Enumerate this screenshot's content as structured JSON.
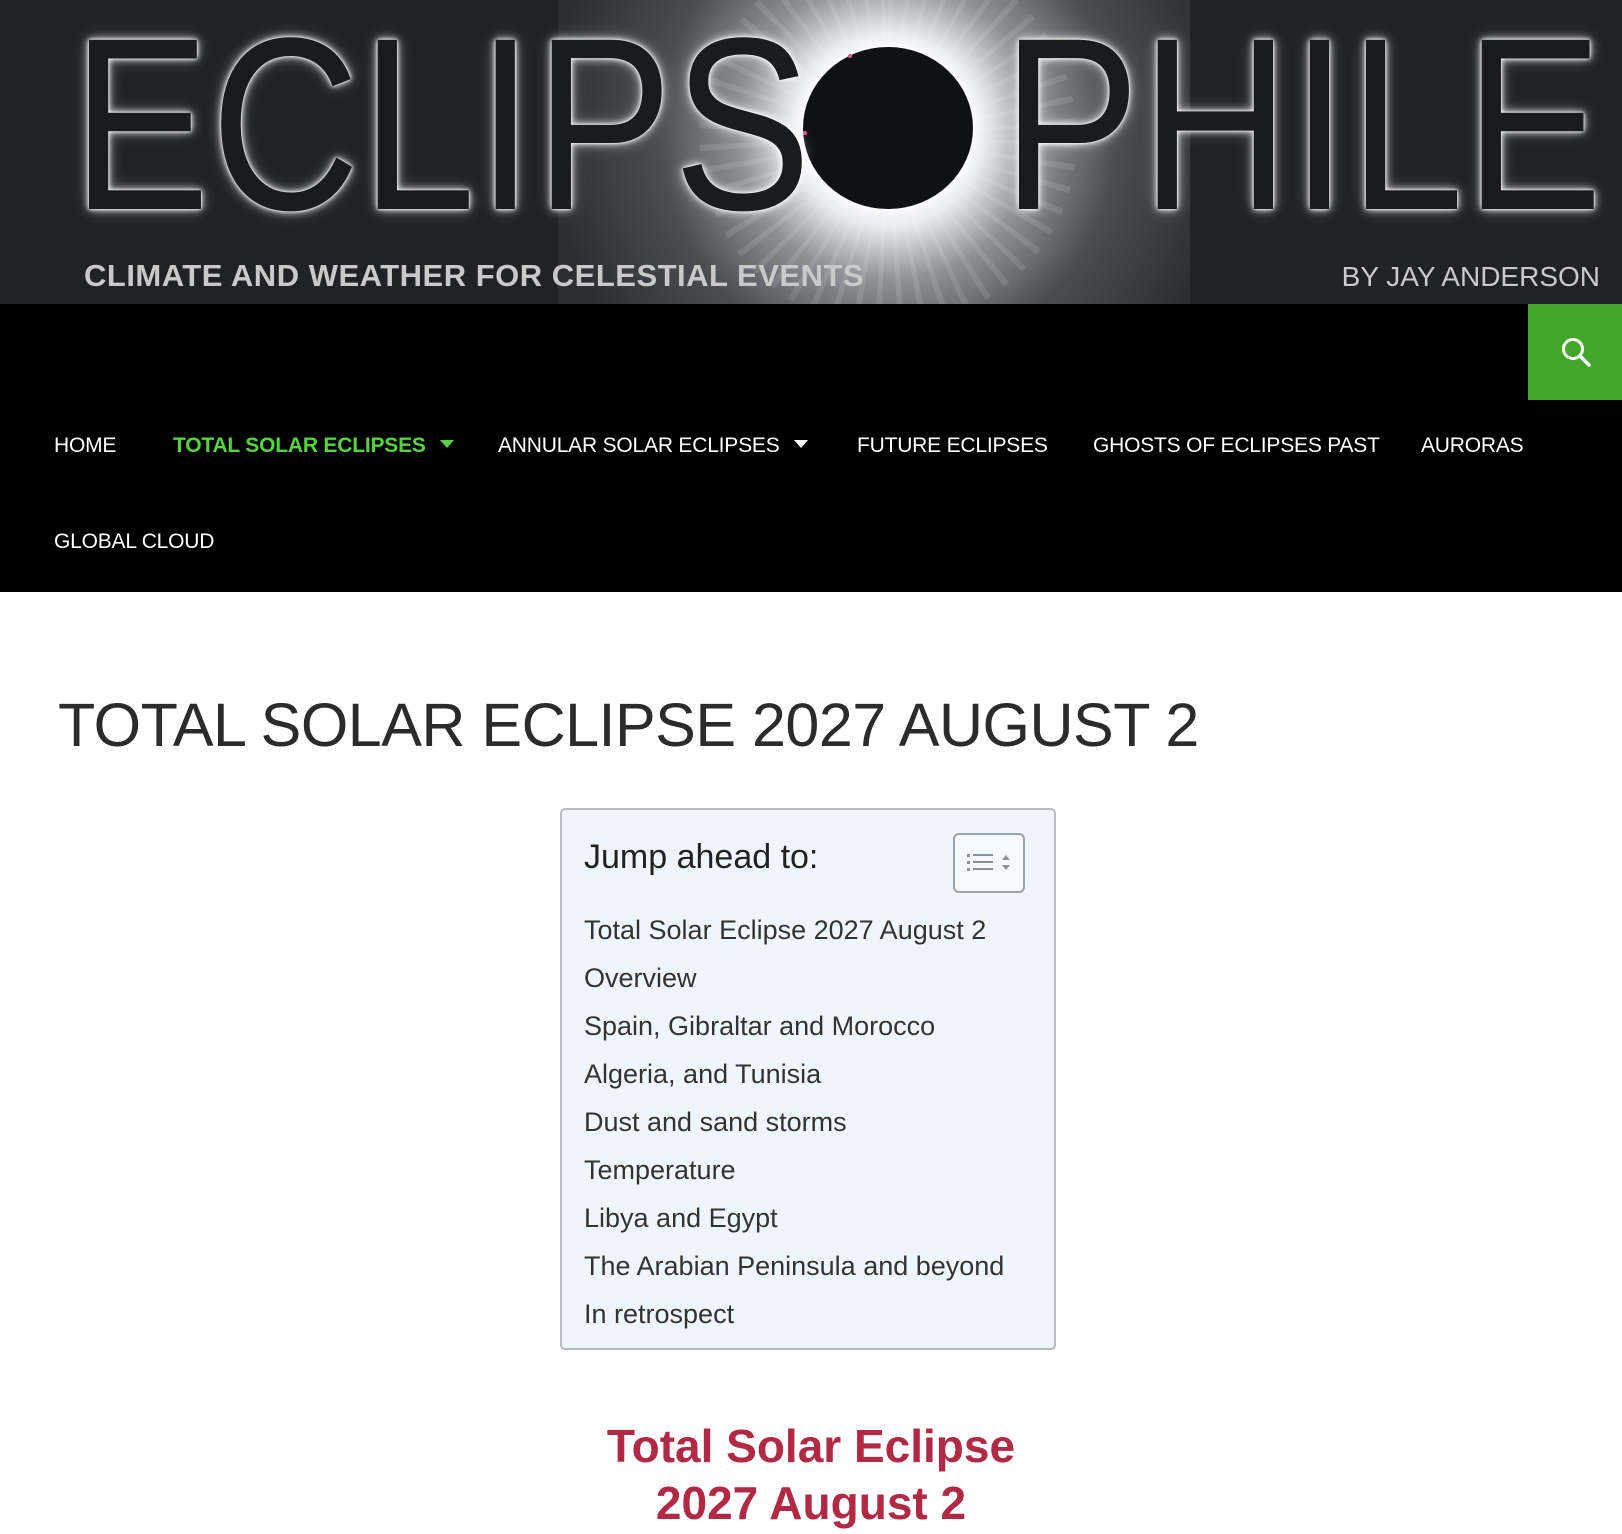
{
  "banner": {
    "logo_left": "ECLIPS",
    "logo_right": "PHILE",
    "tagline": "CLIMATE AND WEATHER FOR CELESTIAL EVENTS",
    "byline": "BY JAY ANDERSON"
  },
  "nav": {
    "search_icon": "search-icon",
    "items": [
      {
        "label": "HOME",
        "has_dropdown": false,
        "active": false
      },
      {
        "label": "TOTAL SOLAR ECLIPSES",
        "has_dropdown": true,
        "active": true
      },
      {
        "label": "ANNULAR SOLAR ECLIPSES",
        "has_dropdown": true,
        "active": false
      },
      {
        "label": "FUTURE ECLIPSES",
        "has_dropdown": false,
        "active": false
      },
      {
        "label": "GHOSTS OF ECLIPSES PAST",
        "has_dropdown": false,
        "active": false
      },
      {
        "label": "AURORAS",
        "has_dropdown": false,
        "active": false
      },
      {
        "label": "GLOBAL CLOUD",
        "has_dropdown": false,
        "active": false
      }
    ]
  },
  "page": {
    "title": "TOTAL SOLAR ECLIPSE 2027 AUGUST 2"
  },
  "toc": {
    "heading": "Jump ahead to:",
    "toggle_icon": "list-toggle-icon",
    "items": [
      "Total Solar Eclipse 2027 August 2",
      "Overview",
      "Spain, Gibraltar and Morocco",
      "Algeria, and Tunisia",
      "Dust and sand storms",
      "Temperature",
      "Libya and Egypt",
      "The Arabian Peninsula and beyond",
      "In retrospect"
    ]
  },
  "section": {
    "heading_line1": "Total Solar Eclipse",
    "heading_line2": "2027 August 2"
  },
  "colors": {
    "nav_bg": "#000000",
    "search_bg": "#41a62a",
    "active_nav": "#55d43f",
    "toc_bg": "#eff5fd",
    "section_heading": "#b12944"
  }
}
